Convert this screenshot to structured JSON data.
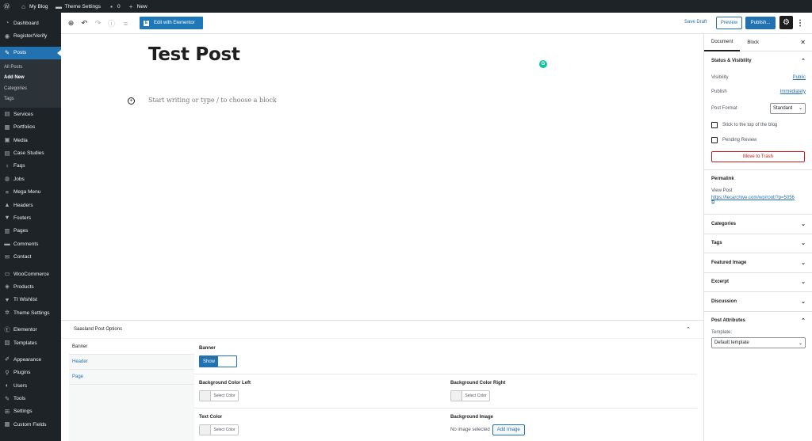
{
  "adminbar": {
    "site_name": "My Blog",
    "theme_settings": "Theme Settings",
    "comments_count": "0",
    "new_label": "New"
  },
  "sidebar": {
    "items": [
      {
        "label": "Dashboard",
        "icon": "dashboard-icon"
      },
      {
        "label": "Register/Verify",
        "icon": "register-icon"
      },
      {
        "label": "Posts",
        "icon": "pin-icon",
        "active": true
      },
      {
        "label": "Services",
        "icon": "services-icon"
      },
      {
        "label": "Portfolios",
        "icon": "portfolio-icon"
      },
      {
        "label": "Media",
        "icon": "media-icon"
      },
      {
        "label": "Case Studies",
        "icon": "case-studies-icon"
      },
      {
        "label": "Faqs",
        "icon": "faqs-icon"
      },
      {
        "label": "Jobs",
        "icon": "jobs-icon"
      },
      {
        "label": "Mega Menu",
        "icon": "menu-icon"
      },
      {
        "label": "Headers",
        "icon": "headers-icon"
      },
      {
        "label": "Footers",
        "icon": "footers-icon"
      },
      {
        "label": "Pages",
        "icon": "pages-icon"
      },
      {
        "label": "Comments",
        "icon": "comments-icon"
      },
      {
        "label": "Contact",
        "icon": "contact-icon"
      },
      {
        "label": "WooCommerce",
        "icon": "woocommerce-icon"
      },
      {
        "label": "Products",
        "icon": "products-icon"
      },
      {
        "label": "TI Wishlist",
        "icon": "wishlist-icon"
      },
      {
        "label": "Theme Settings",
        "icon": "gear-icon"
      },
      {
        "label": "Elementor",
        "icon": "elementor-icon"
      },
      {
        "label": "Templates",
        "icon": "templates-icon"
      },
      {
        "label": "Appearance",
        "icon": "appearance-icon"
      },
      {
        "label": "Plugins",
        "icon": "plugins-icon"
      },
      {
        "label": "Users",
        "icon": "users-icon"
      },
      {
        "label": "Tools",
        "icon": "tools-icon"
      },
      {
        "label": "Settings",
        "icon": "settings-icon"
      },
      {
        "label": "Custom Fields",
        "icon": "custom-fields-icon"
      }
    ],
    "posts_submenu": [
      "All Posts",
      "Add New",
      "Categories",
      "Tags"
    ]
  },
  "header": {
    "edit_with_elementor": "Edit with Elementor",
    "save_draft": "Save Draft",
    "preview": "Preview",
    "publish": "Publish..."
  },
  "editor": {
    "post_title": "Test Post",
    "block_placeholder": "Start writing or type / to choose a block"
  },
  "metabox": {
    "title": "Saasland Post Options",
    "tabs": [
      "Banner",
      "Header",
      "Page"
    ],
    "banner_label": "Banner",
    "toggle_value": "Show",
    "bg_color_left_label": "Background Color Left",
    "bg_color_right_label": "Background Color Right",
    "text_color_label": "Text Color",
    "bg_image_label": "Background Image",
    "select_color": "Select Color",
    "no_image": "No image selected",
    "add_image": "Add Image"
  },
  "settings_sidebar": {
    "tab_document": "Document",
    "tab_block": "Block",
    "status_title": "Status & Visibility",
    "visibility_label": "Visibility",
    "visibility_value": "Public",
    "publish_label": "Publish",
    "publish_value": "Immediately",
    "post_format_label": "Post Format",
    "post_format_value": "Standard",
    "stick_to_top": "Stick to the top of the blog",
    "pending_review": "Pending Review",
    "move_to_trash": "Move to Trash",
    "permalink_title": "Permalink",
    "view_post_label": "View Post",
    "permalink_url": "https://tecarchive.com/wp/root/?p=5056",
    "categories": "Categories",
    "tags": "Tags",
    "featured_image": "Featured Image",
    "excerpt": "Excerpt",
    "discussion": "Discussion",
    "post_attributes": "Post Attributes",
    "template_label": "Template:",
    "template_value": "Default template"
  },
  "colors": {
    "admin_dark": "#1d2327",
    "accent": "#2271b1",
    "elementor": "#1e77b9",
    "trash": "#cc1818",
    "grammarly": "#15c39a"
  }
}
